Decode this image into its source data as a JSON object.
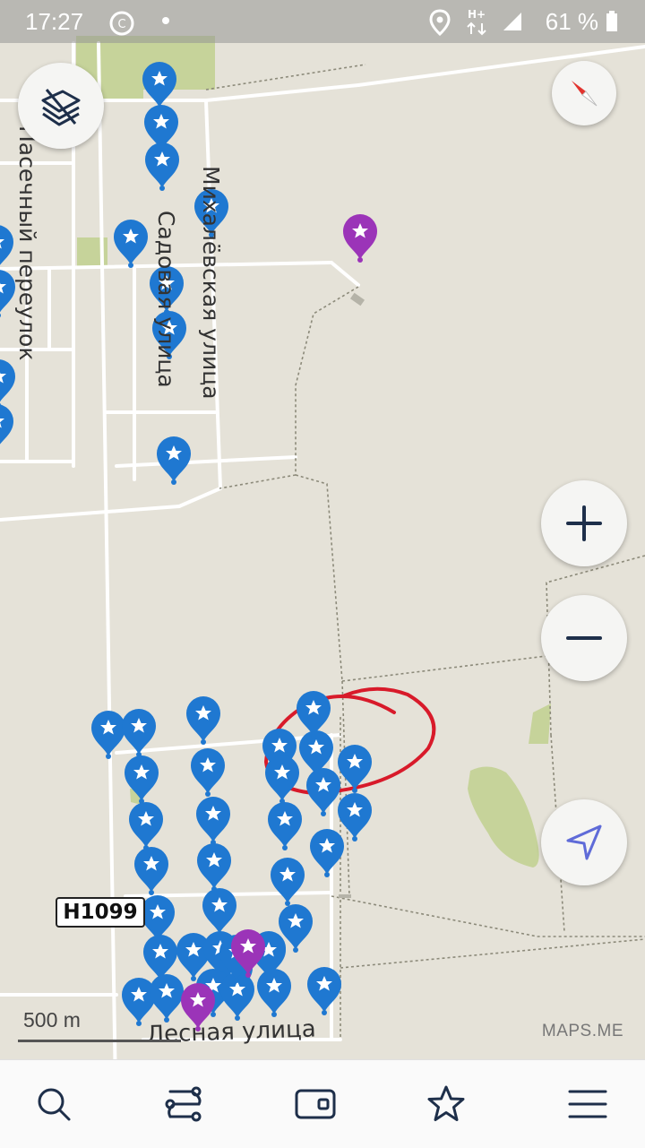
{
  "status_bar": {
    "time": "17:27",
    "battery": "61 %",
    "icons": [
      "sync-icon",
      "dot-icon",
      "location-icon",
      "network-hplus-icon",
      "signal-icon",
      "battery-icon"
    ]
  },
  "map": {
    "streets": {
      "pasechny": "Пасечный переулок",
      "sadovaya": "Садовая улица",
      "mikhalevskaya": "Михалёвская улица",
      "lesnaya": "Лесная улица"
    },
    "route_label": "H1099",
    "scale": "500 m",
    "attribution": "MAPS.ME",
    "colors": {
      "background": "#e5e2d8",
      "pin_blue": "#1f78d1",
      "pin_purple": "#9b34b8",
      "green_area": "#c6d39a",
      "annotation": "#d81a2a"
    },
    "bookmark_count_visible": 50
  },
  "buttons": {
    "layers": "layers-icon",
    "compass": "compass-icon",
    "zoom_in": "zoom-in-icon",
    "zoom_out": "zoom-out-icon",
    "my_position": "my-position-icon"
  },
  "bottom_bar": {
    "tabs": [
      "search-icon",
      "route-icon",
      "wallet-icon",
      "bookmarks-icon",
      "menu-icon"
    ]
  }
}
